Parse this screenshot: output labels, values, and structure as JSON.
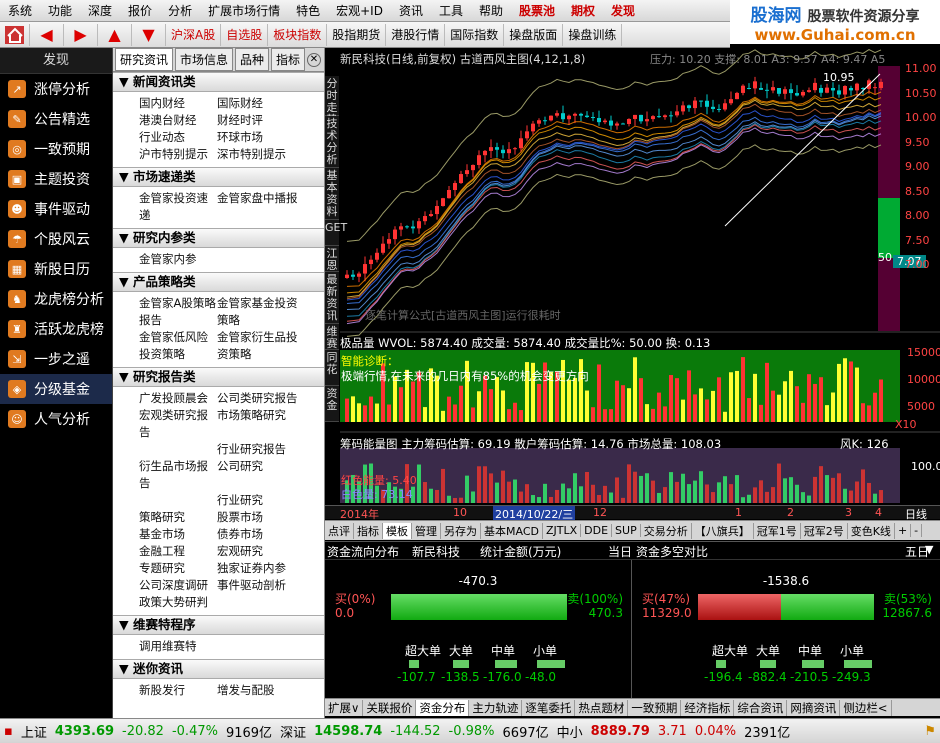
{
  "menubar": {
    "items": [
      "系统",
      "功能",
      "深度",
      "报价",
      "分析",
      "扩展市场行情",
      "特色",
      "宏观+ID",
      "资讯",
      "工具",
      "帮助"
    ],
    "special": [
      "股票池",
      "期权",
      "发现"
    ]
  },
  "logo": {
    "brand": "股海网",
    "tagline": "股票软件资源分享",
    "url": "www.Guhai.com.cn"
  },
  "toolbar": {
    "items": [
      "沪深A股",
      "自选股",
      "板块指数",
      "股指期货",
      "港股行情",
      "国际指数",
      "操盘版面",
      "操盘训练"
    ]
  },
  "leftnav": {
    "title": "发现",
    "items": [
      {
        "label": "涨停分析",
        "icon": "chart-up-icon"
      },
      {
        "label": "公告精选",
        "icon": "document-icon"
      },
      {
        "label": "一致预期",
        "icon": "target-icon"
      },
      {
        "label": "主题投资",
        "icon": "briefcase-icon"
      },
      {
        "label": "事件驱动",
        "icon": "person-icon"
      },
      {
        "label": "个股风云",
        "icon": "umbrella-icon"
      },
      {
        "label": "新股日历",
        "icon": "calendar-icon"
      },
      {
        "label": "龙虎榜分析",
        "icon": "dragon-icon"
      },
      {
        "label": "活跃龙虎榜",
        "icon": "tiger-icon"
      },
      {
        "label": "一步之遥",
        "icon": "steps-icon"
      },
      {
        "label": "分级基金",
        "icon": "fund-icon"
      },
      {
        "label": "人气分析",
        "icon": "people-icon"
      }
    ]
  },
  "research": {
    "tabs": [
      "研究资讯",
      "市场信息",
      "品种",
      "指标"
    ],
    "sections": [
      {
        "title": "新闻资讯类",
        "links": [
          "国内财经",
          "国际财经",
          "港澳台财经",
          "财经时评",
          "行业动态",
          "环球市场",
          "沪市特别提示",
          "深市特别提示"
        ]
      },
      {
        "title": "市场速递类",
        "links": [
          "金管家投资速递",
          "金管家盘中播报"
        ]
      },
      {
        "title": "研究内参类",
        "links": [
          "金管家内参"
        ]
      },
      {
        "title": "产品策略类",
        "links": [
          "金管家A股策略报告",
          "金管家基金投资策略",
          "金管家低风险投资策略",
          "金管家衍生品投资策略"
        ]
      },
      {
        "title": "研究报告类",
        "links": [
          "广发投顾晨会",
          "公司类研究报告",
          "宏观类研究报告",
          "市场策略研究",
          "",
          "行业研究报告",
          "衍生品市场报告",
          "公司研究",
          "",
          "行业研究",
          "策略研究",
          "股票市场",
          "基金市场",
          "债券市场",
          "金融工程",
          "宏观研究",
          "专题研究",
          "独家证券内参",
          "公司深度调研",
          "事件驱动剖析",
          "政策大势研判",
          ""
        ]
      },
      {
        "title": "维赛特程序",
        "links": [
          "调用维赛特"
        ]
      },
      {
        "title": "迷你资讯",
        "links": [
          "新股发行",
          "增发与配股"
        ]
      }
    ]
  },
  "chart": {
    "side_tabs": [
      "分时走势",
      "技术分析",
      "基本资料",
      "GET",
      "江恩",
      "最新资讯",
      "维赛",
      "同花",
      "资金"
    ],
    "title": "新民科技(日线,前复权) 古道西风主图(4,12,1,8)",
    "title_right": "压力: 10.20  支撑: 8.01  A3: 9.57  A4: 9.47  A5",
    "price_ticks": [
      "11.00",
      "10.50",
      "10.00",
      "9.50",
      "9.00",
      "8.50",
      "8.00",
      "7.50",
      "7.00"
    ],
    "price_ticks_wide": [
      "10.50",
      "10.00",
      "9.50",
      "9.00",
      "8.50",
      "8.00",
      "7.50"
    ],
    "high_label": "10.95",
    "low_box": "7.07",
    "side_marker": "50",
    "overlay_text": "逐笔计算公式[古道西风主图]运行很耗时",
    "vol_line": "极品量  WVOL: 5874.40   成交量: 5874.40       成交量比%: 50.00  换: 0.13",
    "vol_ticks": [
      "15000",
      "10000",
      "5000",
      "X10"
    ],
    "diag_title": "智能诊断：",
    "diag_text": "极端行情,在未来的几日内有85%的机会变更方向",
    "chip_line": "筹码能量图   主力筹码估算: 69.19  散户筹码估算: 14.76  市场总量: 108.03",
    "chip_right": "风K: 126",
    "chip_tick": "100.0",
    "chip_labels": [
      "红色能量: 5.40",
      "白色量: 73.14"
    ],
    "date_labels": [
      "2014年",
      "10",
      "2014/10/22/三",
      "12",
      "1",
      "2",
      "3",
      "4"
    ],
    "period": "日线",
    "tool_tabs": [
      "点评",
      "指标",
      "模板",
      "管理",
      "另存为",
      "基本MACD",
      "ZJTLX",
      "DDE",
      "SUP",
      "交易分析",
      "【八旗兵】",
      "冠军1号",
      "冠军2号",
      "变色K线",
      "+",
      "-"
    ]
  },
  "flow": {
    "left_title": "资金流向分布",
    "stock": "新民科技",
    "unit": "统计金额(万元)",
    "period_today": "当日",
    "right_title": "资金多空对比",
    "period_five": "五日",
    "left": {
      "net": "-470.3",
      "buy_label": "买(0%)",
      "buy_val": "0.0",
      "sell_label": "卖(100%)",
      "sell_val": "470.3",
      "buy_frac": 0.0,
      "bars": [
        {
          "label": "超大单",
          "value": "-107.7"
        },
        {
          "label": "大单",
          "value": "-138.5"
        },
        {
          "label": "中单",
          "value": "-176.0"
        },
        {
          "label": "小单",
          "value": "-48.0"
        }
      ]
    },
    "right": {
      "net": "-1538.6",
      "buy_label": "买(47%)",
      "buy_val": "11329.0",
      "sell_label": "卖(53%)",
      "sell_val": "12867.6",
      "buy_frac": 0.47,
      "bars": [
        {
          "label": "超大单",
          "value": "-196.4"
        },
        {
          "label": "大单",
          "value": "-882.4"
        },
        {
          "label": "中单",
          "value": "-210.5"
        },
        {
          "label": "小单",
          "value": "-249.3"
        }
      ]
    }
  },
  "bottom_tabs": [
    "扩展∨",
    "关联报价",
    "资金分布",
    "主力轨迹",
    "逐笔委托",
    "热点题材",
    "一致预期",
    "经济指标",
    "综合资讯",
    "网摘资讯",
    "侧边栏<"
  ],
  "status": {
    "sh": {
      "name": "上证",
      "price": "4393.69",
      "chg": "-20.82",
      "pct": "-0.47%",
      "amt": "9169亿"
    },
    "sz": {
      "name": "深证",
      "price": "14598.74",
      "chg": "-144.52",
      "pct": "-0.98%",
      "amt": "6697亿"
    },
    "zx": {
      "name": "中小",
      "price": "8889.79",
      "chg": "3.71",
      "pct": "0.04%",
      "amt": "2391亿"
    }
  }
}
